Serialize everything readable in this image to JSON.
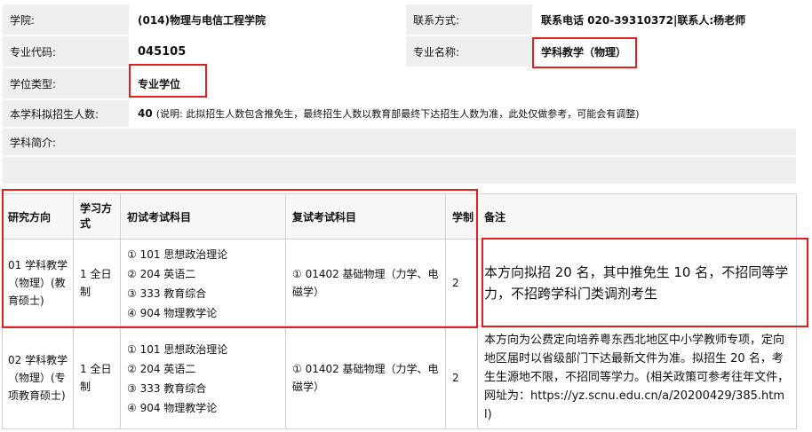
{
  "info": {
    "college_label": "学院:",
    "college_value": "(014)物理与电信工程学院",
    "contact_label": "联系方式:",
    "contact_value": "联系电话 020-39310372|联系人:杨老师",
    "major_code_label": "专业代码:",
    "major_code_value": "045105",
    "major_name_label": "专业名称:",
    "major_name_value": "学科教学（物理）",
    "degree_type_label": "学位类型:",
    "degree_type_value": "专业学位",
    "enroll_label": "本学科拟招生人数:",
    "enroll_count": "40",
    "enroll_note": "(说明: 此拟招生人数包含推免生，最终招生人数以教育部最终下达招生人数为准，此处仅做参考，可能会有调整)",
    "intro_label": "学科简介:"
  },
  "table": {
    "headers": {
      "direction": "研究方向",
      "study_mode": "学习方式",
      "prelim": "初试考试科目",
      "retest": "复试考试科目",
      "duration": "学制",
      "remarks": "备注"
    },
    "rows": [
      {
        "direction": "01 学科教学（物理）(教育硕士)",
        "study_mode": "1 全日制",
        "prelim": [
          "① 101 思想政治理论",
          "② 204 英语二",
          "③ 333 教育综合",
          "④ 904 物理教学论"
        ],
        "retest": "① 01402 基础物理（力学、电磁学）",
        "duration": "2",
        "remarks": "本方向拟招 20 名，其中推免生 10 名，不招同等学力，不招跨学科门类调剂考生"
      },
      {
        "direction": "02 学科教学（物理）(专项教育硕士)",
        "study_mode": "1 全日制",
        "prelim": [
          "① 101 思想政治理论",
          "② 204 英语二",
          "③ 333 教育综合",
          "④ 904 物理教学论"
        ],
        "retest": "① 01402 基础物理（力学、电磁学）",
        "duration": "2",
        "remarks": "本方向为公费定向培养粤东西北地区中小学教师专项，定向地区届时以省级部门下达最新文件为准。拟招生 20 名，考生生源地不限，不招同等学力。(相关政策可参考往年文件，网址为：https://yz.scnu.edu.cn/a/20200429/385.html)"
      }
    ]
  }
}
